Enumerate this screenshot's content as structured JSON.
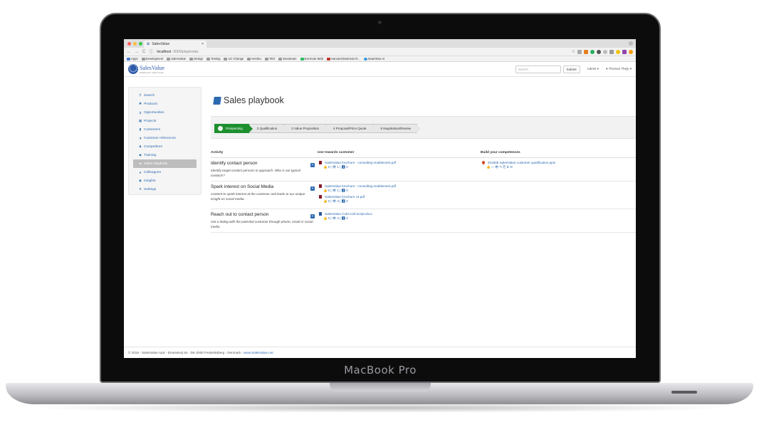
{
  "device": {
    "brand": "MacBook Pro"
  },
  "browser": {
    "tab_title": "SalesValue",
    "tab_close": "×",
    "url_host": "localhost",
    "url_path": ":3000/playbooks",
    "bookmarks": [
      "Apps",
      "Development",
      "SalesValue",
      "Design",
      "Testing",
      "UC Change",
      "Heroku",
      "TEO",
      "Devoteam",
      "Evernote Web",
      "Harvard Business R...",
      "Seamless.AI"
    ]
  },
  "header": {
    "logo_name": "SalesValue",
    "logo_tagline": "Enablement made simple",
    "search_placeholder": "Search",
    "submit_label": "Submit",
    "admin_label": "Admin ▾",
    "user_label": "Thomas Thejn ▾"
  },
  "sidebar": {
    "items": [
      {
        "label": "Search",
        "icon": "search-icon",
        "glyph": "⚲"
      },
      {
        "label": "Products",
        "icon": "products-icon",
        "glyph": "✱"
      },
      {
        "label": "Opportunities",
        "icon": "dollar-icon",
        "glyph": "$"
      },
      {
        "label": "Projects",
        "icon": "calendar-icon",
        "glyph": "▦"
      },
      {
        "label": "Customers",
        "icon": "building-icon",
        "glyph": "▮"
      },
      {
        "label": "Customer references",
        "icon": "trophy-icon",
        "glyph": "▼"
      },
      {
        "label": "Competitors",
        "icon": "chess-icon",
        "glyph": "♟"
      },
      {
        "label": "Training",
        "icon": "graduation-icon",
        "glyph": "◆"
      },
      {
        "label": "Sales Playbook",
        "icon": "book-icon",
        "glyph": "▰"
      },
      {
        "label": "Colleagues",
        "icon": "user-icon",
        "glyph": "●"
      },
      {
        "label": "Insights",
        "icon": "lightbulb-icon",
        "glyph": "◉"
      },
      {
        "label": "Settings",
        "icon": "gear-icon",
        "glyph": "✷"
      }
    ],
    "active_index": 8
  },
  "main": {
    "title": "Sales playbook",
    "steps": [
      "Prospecting",
      "2 Qualification",
      "3 Value Proposition",
      "4 Proposal/Price Quote",
      "5 Negotiation/Review"
    ],
    "columns": [
      "Activity",
      "Use towards customer",
      "Build your competences"
    ],
    "rows": [
      {
        "title": "Identify contact person",
        "desc": "Identify target contact persons to approach. Who is our typical contacts?",
        "docs": [
          {
            "name": "SalesValue brochure - consulting enablement.pdf",
            "stats": "👍 0 | 👁 1 | ⬇ 0",
            "type": "pdf"
          }
        ],
        "competences": [
          {
            "name": "201805 SalesValue customer qualification.pptx",
            "stats": "👍 ☆ 👁 ✎ ⎘ ⬇ ✉",
            "type": "pptx"
          }
        ]
      },
      {
        "title": "Spark interest on Social Media",
        "desc": "Content to spark interest at the customer and leads to our unique insight on social media.",
        "docs": [
          {
            "name": "SalesValue brochure - consulting enablement.pdf",
            "stats": "👍 0 | 👁 1 | ⬇ 0",
            "type": "pdf"
          },
          {
            "name": "SalesValue brochure v4.pdf",
            "stats": "👍 0 | 👁 3 | ⬇ 0",
            "type": "pdf"
          }
        ],
        "competences": []
      },
      {
        "title": "Reach out to contact person",
        "desc": "Get a dialog with the potential customer through phone, email or social media",
        "docs": [
          {
            "name": "SalesValue Cold Call Script.docx",
            "stats": "👍 0 | 👁 2 | ⬇ 0",
            "type": "docx"
          }
        ],
        "competences": []
      }
    ]
  },
  "footer": {
    "text": "© 2018 - SalesValue ApS - Drosselvej 54 - DK-2000 Frederiksberg - Denmark - ",
    "link": "www.SalesValue.net"
  }
}
